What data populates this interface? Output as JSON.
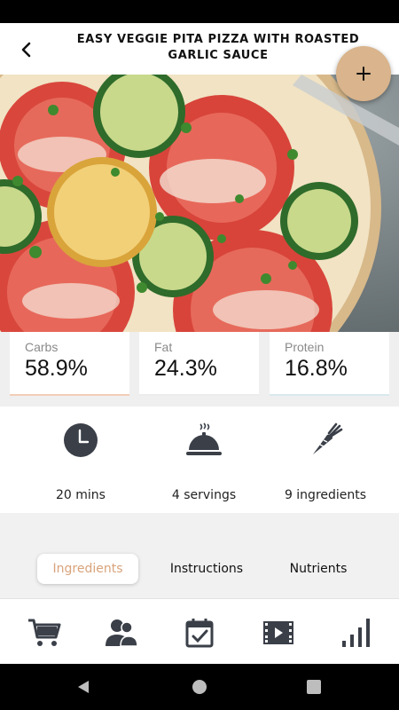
{
  "header": {
    "title": "EASY VEGGIE PITA PIZZA WITH ROASTED GARLIC SAUCE",
    "back_icon": "chevron-left-icon"
  },
  "fab": {
    "icon": "plus-icon",
    "color": "#d9b48c"
  },
  "macros": [
    {
      "label": "Carbs",
      "value": "58.9%",
      "accent": "#f2cdb8"
    },
    {
      "label": "Fat",
      "value": "24.3%",
      "accent": "#ececec"
    },
    {
      "label": "Protein",
      "value": "16.8%",
      "accent": "#d9e9ee"
    }
  ],
  "info": [
    {
      "icon": "clock-icon",
      "text": "20 mins"
    },
    {
      "icon": "serving-dish-icon",
      "text": "4 servings"
    },
    {
      "icon": "carrot-icon",
      "text": "9 ingredients"
    }
  ],
  "tabs": [
    {
      "label": "Ingredients",
      "active": true
    },
    {
      "label": "Instructions",
      "active": false
    },
    {
      "label": "Nutrients",
      "active": false
    }
  ],
  "accent_color": "#d9a37b",
  "bottom_nav": [
    {
      "icon": "shopping-cart-icon"
    },
    {
      "icon": "users-icon"
    },
    {
      "icon": "calendar-check-icon"
    },
    {
      "icon": "video-film-icon"
    },
    {
      "icon": "bar-chart-icon"
    }
  ]
}
